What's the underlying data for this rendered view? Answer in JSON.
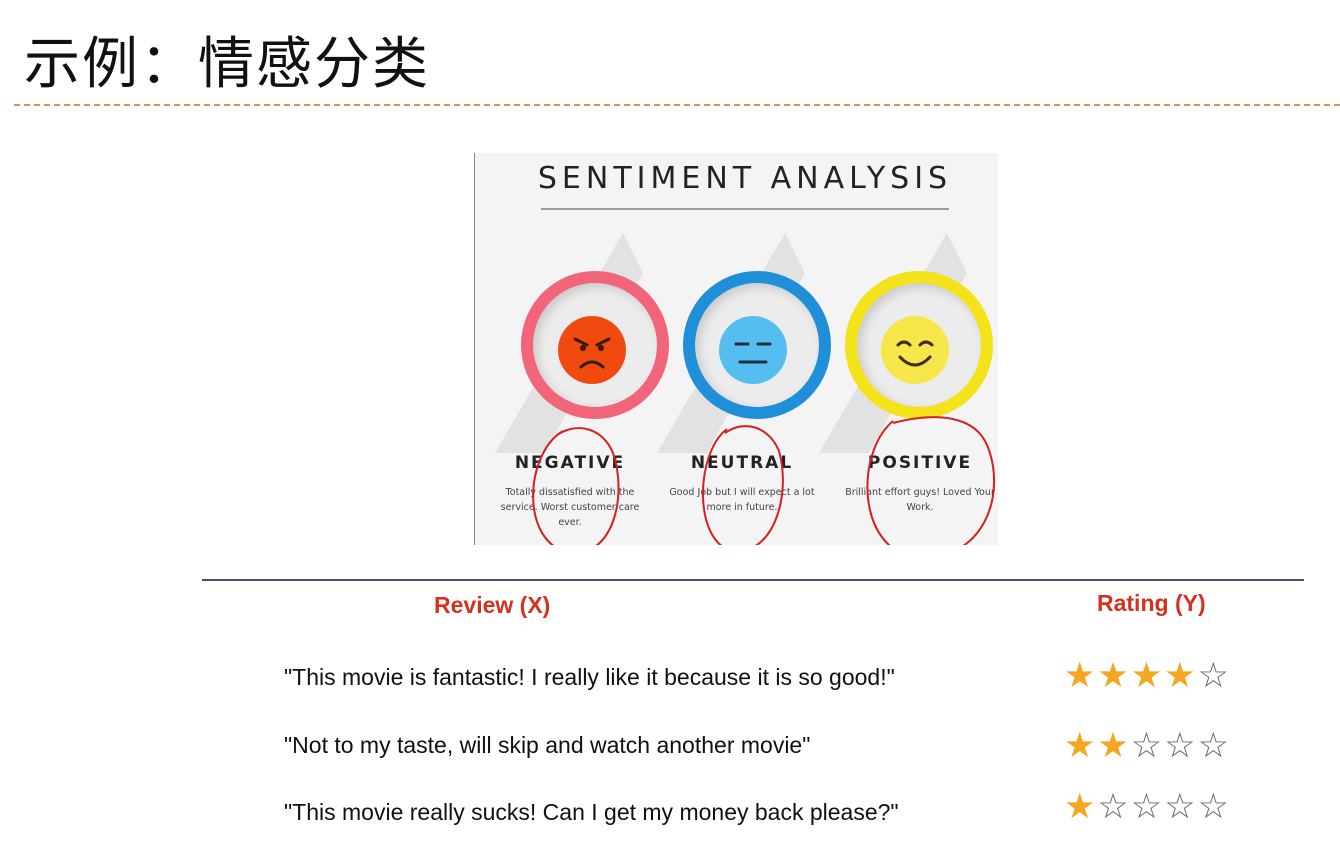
{
  "slide": {
    "title": "示例：情感分类"
  },
  "infographic": {
    "title": "SENTIMENT ANALYSIS",
    "categories": [
      {
        "label": "NEGATIVE",
        "text": "Totally dissatisfied with the service. Worst customer care ever.",
        "color": "#f2647a",
        "face_color": "#f04a10",
        "icon": "angry-face-icon"
      },
      {
        "label": "NEUTRAL",
        "text": "Good Job but I will expect a lot more in future.",
        "color": "#1e8fd8",
        "face_color": "#56bdf0",
        "icon": "neutral-face-icon"
      },
      {
        "label": "POSITIVE",
        "text": "Brilliant effort guys! Loved Your Work.",
        "color": "#f4e21a",
        "face_color": "#f7e64a",
        "icon": "smiling-face-icon"
      }
    ],
    "annotation_color": "#d42020"
  },
  "table": {
    "review_header": "Review (X)",
    "rating_header": "Rating (Y)",
    "max_rating": 5,
    "rows": [
      {
        "review": "\"This movie is fantastic! I really like it because it is so good!\"",
        "rating": 4
      },
      {
        "review": "\"Not to my taste, will skip and watch another movie\"",
        "rating": 2
      },
      {
        "review": "\"This movie really sucks! Can I get my money back please?\"",
        "rating": 1
      }
    ]
  }
}
